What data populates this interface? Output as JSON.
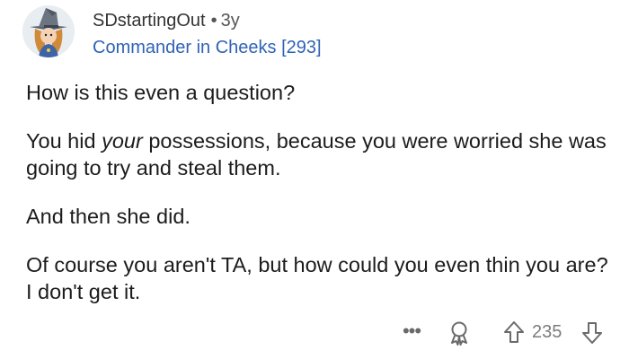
{
  "comment": {
    "author": "SDstartingOut",
    "separator": "•",
    "age": "3y",
    "flair": "Commander in Cheeks [293]",
    "body": {
      "p1": "How is this even a question?",
      "p2_before": "You hid ",
      "p2_emph": "your",
      "p2_after": " possessions, because you were worried she was going to try and steal them.",
      "p3": "And then she did.",
      "p4": "Of course you aren't TA, but how could you even thin you are?  I don't get it."
    },
    "actions": {
      "more": "•••",
      "score": "235"
    }
  },
  "icons": {
    "avatar": "wizard-avatar-icon",
    "more": "more-options-icon",
    "award": "award-icon",
    "upvote": "upvote-arrow-icon",
    "downvote": "downvote-arrow-icon"
  },
  "colors": {
    "flair": "#2f63b6",
    "text": "#1c1c1c",
    "muted": "#7c7c7c"
  }
}
